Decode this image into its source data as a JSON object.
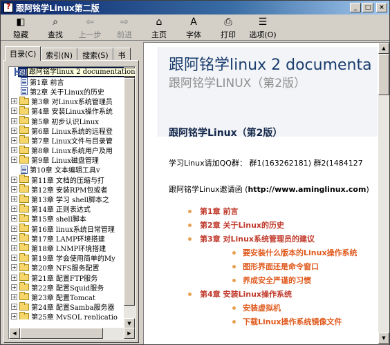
{
  "window": {
    "title": "跟阿铭学Linux第二版"
  },
  "title_buttons": {
    "minimize": "_",
    "maximize": "□",
    "close": "×"
  },
  "toolbar": [
    {
      "label": "隐藏",
      "icon": "hide-icon",
      "glyph": "◧"
    },
    {
      "label": "查找",
      "icon": "find-icon",
      "glyph": "⌕"
    },
    {
      "label": "上一步",
      "icon": "back-icon",
      "glyph": "⇦"
    },
    {
      "label": "前进",
      "icon": "forward-icon",
      "glyph": "⇨"
    },
    {
      "label": "主页",
      "icon": "home-icon",
      "glyph": "⌂"
    },
    {
      "label": "字体",
      "icon": "font-icon",
      "glyph": "A"
    },
    {
      "label": "打印",
      "icon": "print-icon",
      "glyph": "⎙"
    },
    {
      "label": "选项(O)",
      "icon": "options-icon",
      "glyph": "☰"
    }
  ],
  "tabs": [
    "目录(C)",
    "索引(N)",
    "搜索(S)",
    "书"
  ],
  "tree": {
    "tooltip": "跟阿铭学linux 2 documentation",
    "items": [
      {
        "type": "page",
        "label": "跟阿铭学linux 2 documentation",
        "selected": true
      },
      {
        "type": "page",
        "label": "第1章 前言"
      },
      {
        "type": "page",
        "label": "第2章 关于Linux的历史"
      },
      {
        "type": "folder",
        "label": "第3章 对Linux系统管理员"
      },
      {
        "type": "folder",
        "label": "第4章 安装Linux操作系统"
      },
      {
        "type": "folder",
        "label": "第5章 初步认识Linux"
      },
      {
        "type": "folder",
        "label": "第6章 Linux系统的远程登"
      },
      {
        "type": "folder",
        "label": "第7章 Linux文件与目录管"
      },
      {
        "type": "folder",
        "label": "第8章 Linux系统用户及用"
      },
      {
        "type": "folder",
        "label": "第9章 Linux磁盘管理"
      },
      {
        "type": "page",
        "label": "第10章    文本编辑工具v"
      },
      {
        "type": "folder",
        "label": "第11章    文档的压缩与打"
      },
      {
        "type": "folder",
        "label": "第12章    安装RPM包或者"
      },
      {
        "type": "folder",
        "label": "第13章 学习 shell脚本之"
      },
      {
        "type": "folder",
        "label": "第14章 正则表达式"
      },
      {
        "type": "folder",
        "label": "第15章 shell脚本"
      },
      {
        "type": "folder",
        "label": "第16章 linux系统日常管理"
      },
      {
        "type": "folder",
        "label": "第17章 LAMP环境搭建"
      },
      {
        "type": "folder",
        "label": "第18章 LNMP环境搭建"
      },
      {
        "type": "folder",
        "label": "第19章 学会使用简单的My"
      },
      {
        "type": "folder",
        "label": "第20章 NFS服务配置"
      },
      {
        "type": "folder",
        "label": "第21章 配置FTP服务"
      },
      {
        "type": "folder",
        "label": "第22章 配置Squid服务"
      },
      {
        "type": "folder",
        "label": "第23章 配置Tomcat"
      },
      {
        "type": "folder",
        "label": "第24章 配置Samba服务器"
      },
      {
        "type": "folder",
        "label": "第25章 MySQL replicatio"
      }
    ]
  },
  "content": {
    "title": "跟阿铭学linux 2 documenta",
    "subtitle": "跟阿铭学LINUX（第2版）",
    "heading": "跟阿铭学Linux（第2版）",
    "qq_text": "学习Linux请加QQ群： 群1(163262181) 群2(1484127",
    "site_prefix": "跟阿铭学Linux邀请函 (",
    "site_url": "http://www.aminglinux.com",
    "site_suffix": ")",
    "toc": [
      {
        "level": 0,
        "text": "第1章 前言"
      },
      {
        "level": 0,
        "text": "第2章 关于Linux的历史"
      },
      {
        "level": 0,
        "text": "第3章 对Linux系统管理员的建议"
      },
      {
        "level": 1,
        "text": "要安装什么版本的Linux操作系统"
      },
      {
        "level": 1,
        "text": "图形界面还是命令窗口"
      },
      {
        "level": 1,
        "text": "养成安全严谨的习惯"
      },
      {
        "level": 0,
        "text": "第4章 安装Linux操作系统"
      },
      {
        "level": 1,
        "text": "安装虚拟机"
      },
      {
        "level": 1,
        "text": "下载Linux操作系统镜像文件"
      }
    ]
  },
  "colors": {
    "selection": "#0a246a",
    "title_blue": "#1a3d6e",
    "toc_red": "#c0392b",
    "toc_orange": "#e05a1e"
  }
}
